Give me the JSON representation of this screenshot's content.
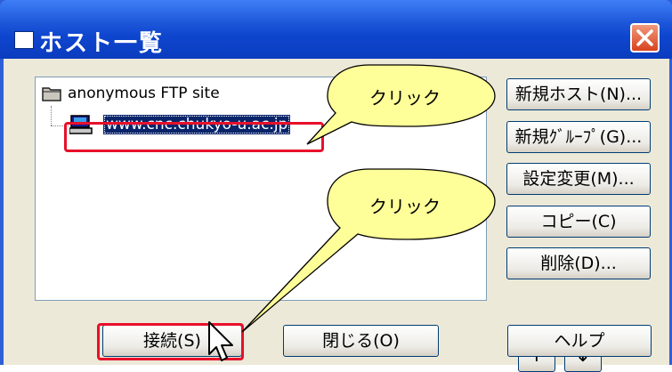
{
  "window": {
    "title": "ホスト一覧"
  },
  "tree": {
    "root": "anonymous FTP site",
    "host": "www.cnc.chukyo-u.ac.jp"
  },
  "buttons": {
    "new_host": "新規ホスト(N)...",
    "new_group": "新規ｸﾞﾙｰﾌﾟ(G)...",
    "change_settings": "設定変更(M)...",
    "copy": "コピー(C)",
    "delete": "削除(D)...",
    "up": "↑",
    "down": "↓",
    "connect": "接続(S)",
    "close": "閉じる(O)",
    "help": "ヘルプ"
  },
  "callouts": {
    "top": "クリック",
    "bottom": "クリック"
  },
  "colors": {
    "highlight": "#e8102a",
    "callout_fill": "#ffff99",
    "selection": "#0a246a"
  }
}
